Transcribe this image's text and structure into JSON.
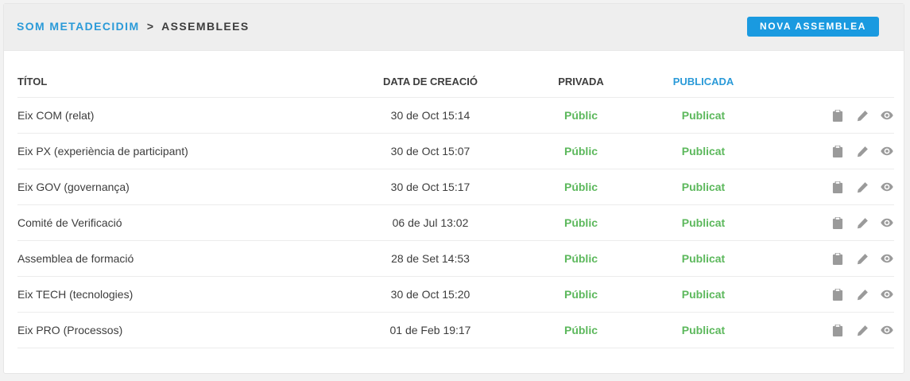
{
  "breadcrumb": {
    "parent": "Som Metadecidim",
    "separator": ">",
    "current": "Assemblees"
  },
  "header": {
    "new_button_label": "Nova Assemblea"
  },
  "table": {
    "columns": {
      "title": "Títol",
      "created": "Data de creació",
      "private": "Privada",
      "published": "Publicada"
    },
    "sorted_column": "published",
    "rows": [
      {
        "title": "Eix COM (relat)",
        "created": "30 de Oct 15:14",
        "private": "Públic",
        "published": "Publicat"
      },
      {
        "title": "Eix PX (experiència de participant)",
        "created": "30 de Oct 15:07",
        "private": "Públic",
        "published": "Publicat"
      },
      {
        "title": "Eix GOV (governança)",
        "created": "30 de Oct 15:17",
        "private": "Públic",
        "published": "Publicat"
      },
      {
        "title": "Comité de Verificació",
        "created": "06 de Jul 13:02",
        "private": "Públic",
        "published": "Publicat"
      },
      {
        "title": "Assemblea de formació",
        "created": "28 de Set 14:53",
        "private": "Públic",
        "published": "Publicat"
      },
      {
        "title": "Eix TECH (tecnologies)",
        "created": "30 de Oct 15:20",
        "private": "Públic",
        "published": "Publicat"
      },
      {
        "title": "Eix PRO (Processos)",
        "created": "01 de Feb 19:17",
        "private": "Públic",
        "published": "Publicat"
      }
    ],
    "row_actions": [
      "clipboard-icon",
      "pencil-icon",
      "eye-icon"
    ]
  },
  "colors": {
    "accent": "#1a9ae0",
    "link": "#2a9ad8",
    "success": "#5cb85c",
    "icon": "#9a9a9a"
  }
}
